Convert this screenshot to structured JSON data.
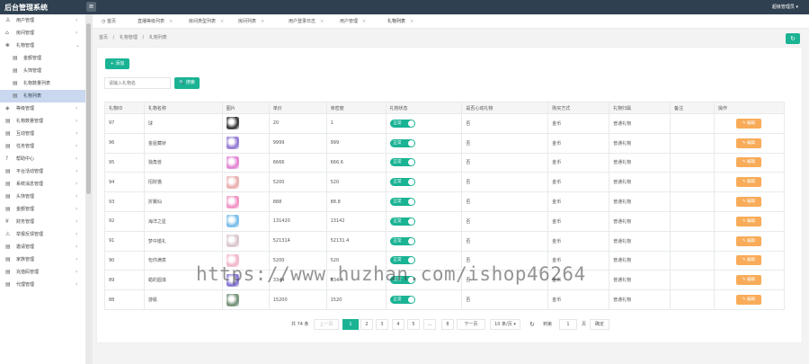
{
  "app": {
    "title": "后台管理系统",
    "user_label": "超级管理员 ▾"
  },
  "sidebar": {
    "items": [
      {
        "label": "用户管理",
        "icon": "user-icon",
        "expanded": false
      },
      {
        "label": "房间管理",
        "icon": "home-icon",
        "expanded": false
      },
      {
        "label": "礼物管理",
        "icon": "gift-icon",
        "expanded": true
      },
      {
        "label": "金额管理",
        "icon": "file-icon",
        "sub": true
      },
      {
        "label": "头饰管理",
        "icon": "file-icon",
        "sub": true
      },
      {
        "label": "礼物数量列表",
        "icon": "file-icon",
        "sub": true
      },
      {
        "label": "礼物列表",
        "icon": "file-icon",
        "sub": true,
        "active": true
      },
      {
        "label": "等级管理",
        "icon": "diamond-icon",
        "expanded": false
      },
      {
        "label": "礼物数量管理",
        "icon": "file-icon",
        "expanded": false
      },
      {
        "label": "互动管理",
        "icon": "file-icon",
        "expanded": false
      },
      {
        "label": "任务管理",
        "icon": "file-icon",
        "expanded": false
      },
      {
        "label": "帮助中心",
        "icon": "help-icon",
        "expanded": false
      },
      {
        "label": "平台活动管理",
        "icon": "file-icon",
        "expanded": false
      },
      {
        "label": "系统消息管理",
        "icon": "file-icon",
        "expanded": false
      },
      {
        "label": "头饰管理",
        "icon": "file-icon",
        "expanded": false
      },
      {
        "label": "金额管理",
        "icon": "file-icon",
        "expanded": false
      },
      {
        "label": "财务管理",
        "icon": "money-icon",
        "expanded": false
      },
      {
        "label": "举报反馈管理",
        "icon": "warning-icon",
        "expanded": false
      },
      {
        "label": "邀请管理",
        "icon": "file-icon",
        "expanded": false
      },
      {
        "label": "家族管理",
        "icon": "file-icon",
        "expanded": false
      },
      {
        "label": "充值码管理",
        "icon": "file-icon",
        "expanded": false
      },
      {
        "label": "代理管理",
        "icon": "file-icon",
        "expanded": false
      }
    ]
  },
  "tabs": [
    {
      "label": "首页",
      "closable": false
    },
    {
      "label": "直播等级列表",
      "closable": true
    },
    {
      "label": "房间类型列表",
      "closable": true
    },
    {
      "label": "房间列表",
      "closable": true
    },
    {
      "label": "用户登录日志",
      "closable": true
    },
    {
      "label": "用户管理",
      "closable": true
    },
    {
      "label": "礼物列表",
      "closable": true,
      "active": true
    }
  ],
  "breadcrumb": {
    "items": [
      "首页",
      "礼物管理",
      "礼物列表"
    ],
    "separator": "/"
  },
  "toolbar": {
    "add_label": "+ 添加",
    "search_placeholder": "请输入礼物名",
    "search_label": "🔍 搜索"
  },
  "table": {
    "columns": [
      "礼物ID",
      "礼物名称",
      "图片",
      "单价",
      "亲密度",
      "礼物状态",
      "是否心动礼物",
      "购买方式",
      "礼物归属",
      "备注",
      "操作"
    ],
    "status_label": "正常",
    "edit_label": "✎ 编辑",
    "rows": [
      {
        "id": "97",
        "name": "球",
        "price": "20",
        "intimacy": "1",
        "heart": "否",
        "pay": "金币",
        "owner": "普通礼物",
        "note": "",
        "thumb": "#2a2a2a"
      },
      {
        "id": "96",
        "name": "金屋藏娇",
        "price": "9999",
        "intimacy": "999",
        "heart": "否",
        "pay": "金币",
        "owner": "普通礼物",
        "note": "",
        "thumb": "#8a6fd0"
      },
      {
        "id": "95",
        "name": "独角兽",
        "price": "6666",
        "intimacy": "666.6",
        "heart": "否",
        "pay": "金币",
        "owner": "普通礼物",
        "note": "",
        "thumb": "#e07ad0"
      },
      {
        "id": "94",
        "name": "招财猫",
        "price": "5200",
        "intimacy": "520",
        "heart": "否",
        "pay": "金币",
        "owner": "普通礼物",
        "note": "",
        "thumb": "#e8a8a8"
      },
      {
        "id": "93",
        "name": "折翼仙",
        "price": "888",
        "intimacy": "88.8",
        "heart": "否",
        "pay": "金币",
        "owner": "普通礼物",
        "note": "",
        "thumb": "#f08ac0"
      },
      {
        "id": "92",
        "name": "海洋之星",
        "price": "131420",
        "intimacy": "13142",
        "heart": "否",
        "pay": "金币",
        "owner": "普通礼物",
        "note": "",
        "thumb": "#6fb8e8"
      },
      {
        "id": "91",
        "name": "梦中婚礼",
        "price": "521314",
        "intimacy": "52131.4",
        "heart": "否",
        "pay": "金币",
        "owner": "普通礼物",
        "note": "",
        "thumb": "#d8c0c8"
      },
      {
        "id": "90",
        "name": "包你满意",
        "price": "5200",
        "intimacy": "520",
        "heart": "否",
        "pay": "金币",
        "owner": "普通礼物",
        "note": "",
        "thumb": "#f0b0c8"
      },
      {
        "id": "89",
        "name": "蜡的圆滚",
        "price": "3344",
        "intimacy": "334.4",
        "heart": "否",
        "pay": "金币",
        "owner": "普通礼物",
        "note": "",
        "thumb": "#7a6ad0"
      },
      {
        "id": "88",
        "name": "游艇",
        "price": "15200",
        "intimacy": "1520",
        "heart": "否",
        "pay": "金币",
        "owner": "普通礼物",
        "note": "",
        "thumb": "#6a8a70"
      }
    ]
  },
  "pagination": {
    "total": "共 74 条",
    "prev": "上一页",
    "pages": [
      "1",
      "2",
      "3",
      "4",
      "5",
      "...",
      "8"
    ],
    "next": "下一页",
    "page_size": "10 条/页 ▾",
    "goto_label": "到第",
    "goto_value": "1",
    "page_unit": "页",
    "confirm": "确定"
  },
  "watermark": "https://www.huzhan.com/ishop46264",
  "colors": {
    "primary": "#1ab394",
    "warning": "#f8ac59",
    "topbar": "#2f4050"
  }
}
